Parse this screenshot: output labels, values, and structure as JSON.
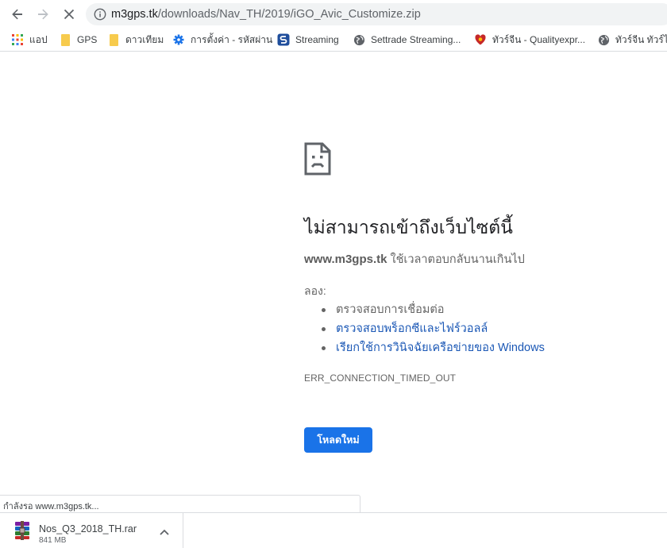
{
  "toolbar": {
    "url_host": "m3gps.tk",
    "url_path": "/downloads/Nav_TH/2019/iGO_Avic_Customize.zip"
  },
  "bookmarks": [
    {
      "label": "แอป",
      "icon": "apps-grid-icon"
    },
    {
      "label": "GPS",
      "icon": "folder-icon"
    },
    {
      "label": "ดาวเทียม",
      "icon": "folder-icon"
    },
    {
      "label": "การตั้งค่า - รหัสผ่าน",
      "icon": "gear-icon"
    },
    {
      "label": "Streaming",
      "icon": "streaming-app-icon"
    },
    {
      "label": "Settrade Streaming...",
      "icon": "globe-icon"
    },
    {
      "label": "ทัวร์จีน - Qualityexpr...",
      "icon": "heart-logo-icon"
    },
    {
      "label": "ทัวร์จีน ทัวร์ไ",
      "icon": "globe-icon"
    }
  ],
  "error": {
    "title": "ไม่สามารถเข้าถึงเว็บไซต์นี้",
    "host": "www.m3gps.tk",
    "message": " ใช้เวลาตอบกลับนานเกินไป",
    "try_label": "ลอง:",
    "suggestions": [
      {
        "text": "ตรวจสอบการเชื่อมต่อ",
        "link": false
      },
      {
        "text": "ตรวจสอบพร็อกซีและไฟร์วอลล์",
        "link": true
      },
      {
        "text": "เรียกใช้การวินิจฉัยเครือข่ายของ Windows",
        "link": true
      }
    ],
    "code": "ERR_CONNECTION_TIMED_OUT",
    "reload_label": "โหลดใหม่"
  },
  "status_bar": {
    "text": "กำลังรอ www.m3gps.tk..."
  },
  "download": {
    "filename": "Nos_Q3_2018_TH.rar",
    "size": "841 MB"
  },
  "colors": {
    "accent": "#1a73e8",
    "link": "#1a57b5",
    "folder": "#f7cb4d"
  }
}
